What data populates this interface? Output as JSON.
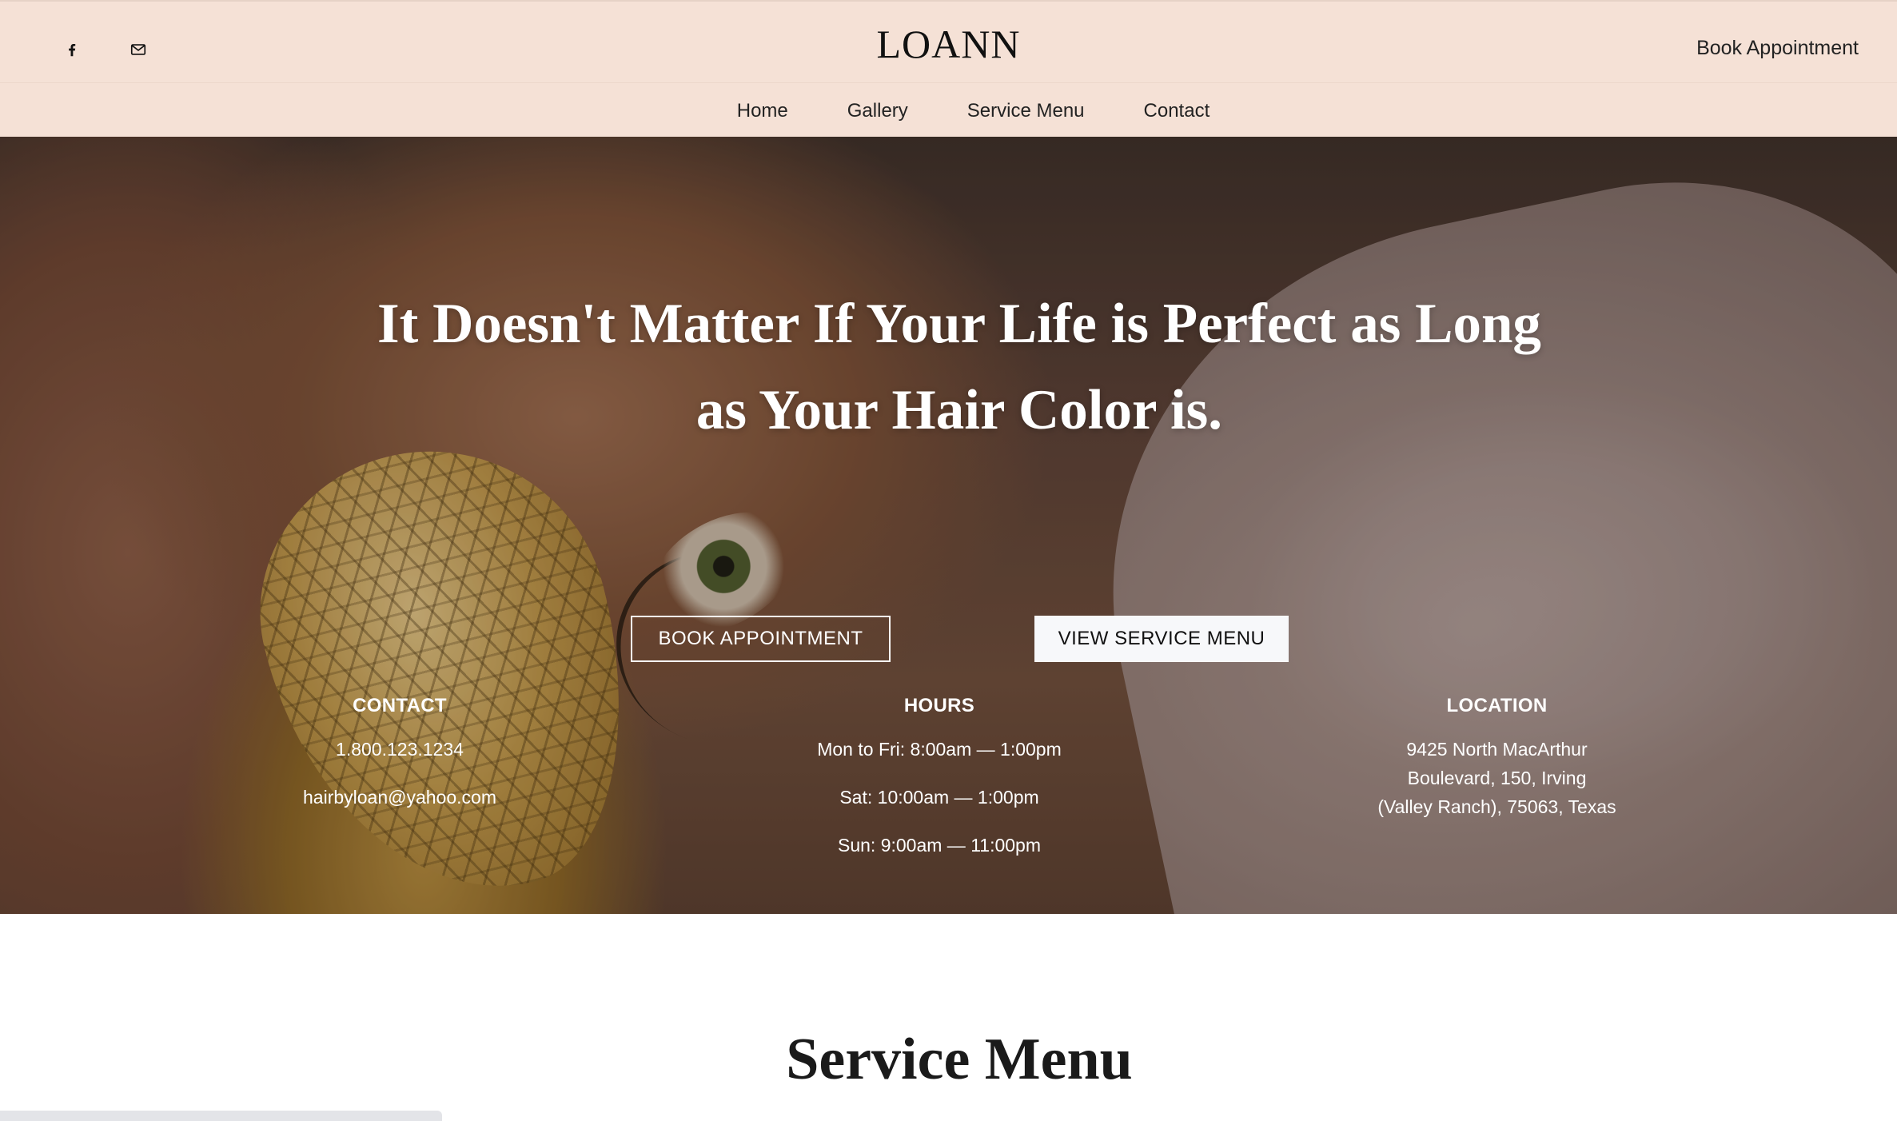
{
  "header": {
    "logo": "LOANN",
    "book_link": "Book Appointment",
    "social": [
      "facebook-icon",
      "mail-icon"
    ],
    "nav": [
      "Home",
      "Gallery",
      "Service Menu",
      "Contact"
    ]
  },
  "hero": {
    "headline_line1": "It Doesn't Matter If Your Life is Perfect as Long",
    "headline_line2": "as Your Hair Color is.",
    "button_book": "BOOK APPOINTMENT",
    "button_menu": "VIEW SERVICE MENU",
    "contact": {
      "title": "CONTACT",
      "phone": "1.800.123.1234",
      "email": "hairbyloan@yahoo.com"
    },
    "hours": {
      "title": "HOURS",
      "weekdays": "Mon to Fri: 8:00am — 1:00pm",
      "saturday": "Sat: 10:00am — 1:00pm",
      "sunday": "Sun: 9:00am — 11:00pm"
    },
    "location": {
      "title": "LOCATION",
      "line1": "9425 North MacArthur",
      "line2": "Boulevard, 150, Irving",
      "line3": "(Valley Ranch), 75063, Texas"
    }
  },
  "section": {
    "title": "Service Menu"
  },
  "colors": {
    "header_bg": "#f5e1d6",
    "button_light_bg": "#f7f8fa",
    "text_dark": "#222222"
  }
}
